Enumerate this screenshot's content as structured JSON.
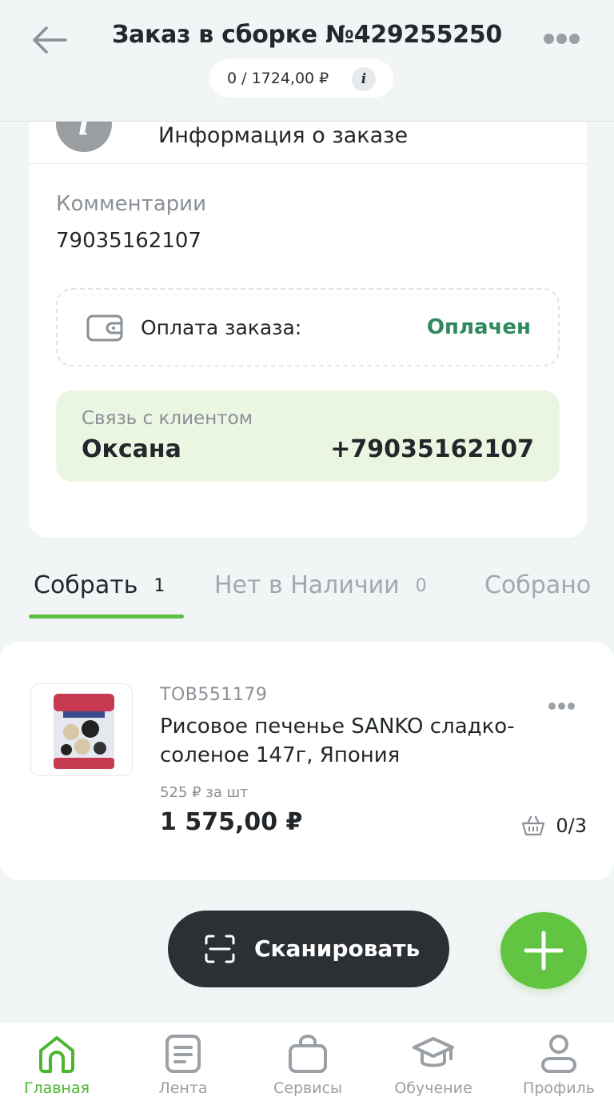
{
  "header": {
    "title": "Заказ в сборке №429255250",
    "amount": "0 / 1724,00 ₽",
    "back_icon": "arrow-left-icon",
    "more_icon": "more-dots-icon",
    "info_icon": "info-icon"
  },
  "order_info": {
    "partial_label": "Информация о заказе",
    "comment_label": "Комментарии",
    "comment_value": "79035162107",
    "payment": {
      "label": "Оплата заказа:",
      "status": "Оплачен",
      "status_color": "#2e8a5e"
    },
    "contact": {
      "caption": "Связь с клиентом",
      "name": "Оксана",
      "phone": "+79035162107"
    }
  },
  "tabs": [
    {
      "label": "Собрать",
      "count": "1",
      "active": true
    },
    {
      "label": "Нет в Наличии",
      "count": "0",
      "active": false
    },
    {
      "label": "Собрано",
      "count": "",
      "active": false
    }
  ],
  "product": {
    "code": "ТОВ551179",
    "name": "Рисовое печенье SANKO сладко-соленое 147г, Япония",
    "unit_price": "525 ₽ за шт",
    "total_price": "1 575,00 ₽",
    "quantity": "0/3"
  },
  "actions": {
    "scan_label": "Сканировать",
    "add_icon": "plus-icon"
  },
  "bottom_nav": [
    {
      "label": "Главная",
      "icon": "home-icon",
      "active": true
    },
    {
      "label": "Лента",
      "icon": "feed-icon",
      "active": false
    },
    {
      "label": "Сервисы",
      "icon": "services-bag-icon",
      "active": false
    },
    {
      "label": "Обучение",
      "icon": "education-cap-icon",
      "active": false
    },
    {
      "label": "Профиль",
      "icon": "profile-icon",
      "active": false
    }
  ],
  "colors": {
    "accent_green": "#5bbf3f",
    "contact_bg": "#eaf5e2",
    "dark_button": "#2b3035"
  }
}
